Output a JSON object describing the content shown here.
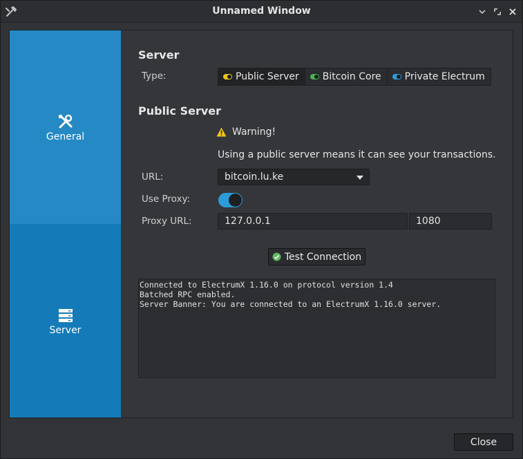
{
  "window": {
    "title": "Unnamed Window",
    "app_icon": "wrench-icon",
    "controls": [
      "minimize-icon",
      "maximize-icon",
      "close-icon"
    ]
  },
  "sidebar": {
    "items": [
      {
        "label": "General",
        "icon": "tools-icon",
        "selected": false
      },
      {
        "label": "Server",
        "icon": "server-icon",
        "selected": true
      }
    ]
  },
  "server_section": {
    "heading": "Server",
    "type_label": "Type:",
    "types": [
      {
        "label": "Public Server",
        "dot_color": "#e8c51c",
        "selected": true
      },
      {
        "label": "Bitcoin Core",
        "dot_color": "#4caf50",
        "selected": false
      },
      {
        "label": "Private Electrum",
        "dot_color": "#2d9bd8",
        "selected": false
      }
    ]
  },
  "public_server": {
    "heading": "Public Server",
    "warning_title": "Warning!",
    "warning_text": "Using a public server means it can see your transactions.",
    "url_label": "URL:",
    "url_value": "bitcoin.lu.ke",
    "use_proxy_label": "Use Proxy:",
    "use_proxy_on": true,
    "proxy_url_label": "Proxy URL:",
    "proxy_host": "127.0.0.1",
    "proxy_port": "1080",
    "test_button": "Test Connection",
    "log_text": "Connected to ElectrumX 1.16.0 on protocol version 1.4\nBatched RPC enabled.\nServer Banner: You are connected to an ElectrumX 1.16.0 server."
  },
  "footer": {
    "close_button": "Close"
  },
  "colors": {
    "accent": "#2d9bd8",
    "sidebar_general": "#2489c4",
    "sidebar_server": "#157bb8",
    "warning": "#f0c419",
    "success": "#5cb85c"
  }
}
